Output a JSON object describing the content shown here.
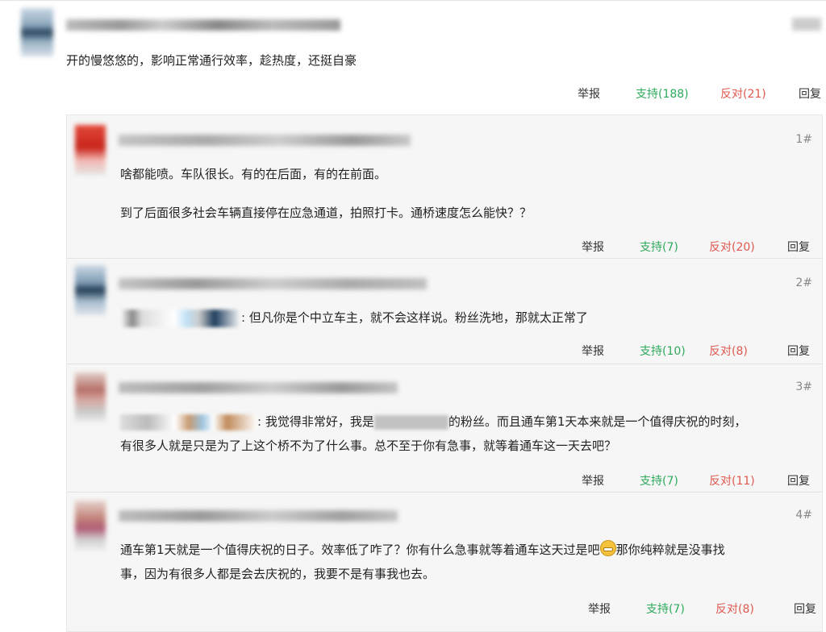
{
  "main_comment": {
    "text": "开的慢悠悠的，影响正常通行效率，趁热度，还挺自豪",
    "actions": {
      "report": "举报",
      "support": "支持(188)",
      "oppose": "反对(21)",
      "reply": "回复"
    }
  },
  "replies": [
    {
      "floor": "1#",
      "paragraphs": [
        "啥都能喷。车队很长。有的在后面，有的在前面。",
        "到了后面很多社会车辆直接停在应急通道，拍照打卡。通桥速度怎么能快？？"
      ],
      "actions": {
        "report": "举报",
        "support": "支持(7)",
        "oppose": "反对(20)",
        "reply": "回复"
      }
    },
    {
      "floor": "2#",
      "text": ": 但凡你是个中立车主，就不会这样说。粉丝洗地，那就太正常了",
      "actions": {
        "report": "举报",
        "support": "支持(10)",
        "oppose": "反对(8)",
        "reply": "回复"
      }
    },
    {
      "floor": "3#",
      "text_a": ": 我觉得非常好，我是",
      "text_b": "的粉丝。而且通车第1天本来就是一个值得庆祝的时刻，",
      "text_c": "有很多人就是只是为了上这个桥不为了什么事。总不至于你有急事，就等着通车这一天去吧？",
      "actions": {
        "report": "举报",
        "support": "支持(7)",
        "oppose": "反对(11)",
        "reply": "回复"
      }
    },
    {
      "floor": "4#",
      "text_a": "通车第1天就是一个值得庆祝的日子。效率低了咋了？你有什么急事就等着通车这天过是吧",
      "text_b": "那你纯粹就是没事找",
      "text_c": "事，因为有很多人都是会去庆祝的，我要不是有事我也去。",
      "emoji": "grin-emoji",
      "actions": {
        "report": "举报",
        "support": "支持(7)",
        "oppose": "反对(8)",
        "reply": "回复"
      }
    }
  ]
}
